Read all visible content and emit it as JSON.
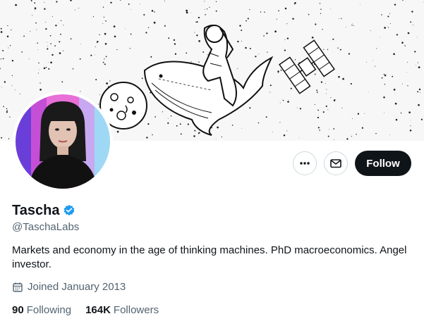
{
  "profile": {
    "name": "Tascha",
    "handle": "@TaschaLabs",
    "bio": "Markets and economy in the age of thinking machines. PhD macroeconomics. Angel investor.",
    "joined": "Joined January 2013",
    "verified": true
  },
  "stats": {
    "following_count": "90",
    "following_label": "Following",
    "followers_count": "164K",
    "followers_label": "Followers"
  },
  "actions": {
    "follow_label": "Follow",
    "more_icon": "more-horizontal-icon",
    "message_icon": "envelope-icon"
  },
  "icons": {
    "verified": "verified-badge-icon",
    "calendar": "calendar-icon"
  },
  "colors": {
    "verified_blue": "#1d9bf0",
    "follow_bg": "#0f1419",
    "secondary_text": "#536471",
    "border": "#cfd9de"
  }
}
